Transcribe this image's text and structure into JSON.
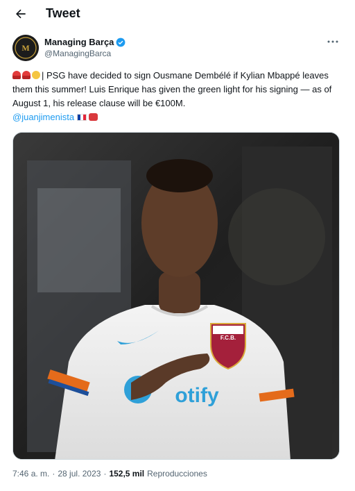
{
  "header": {
    "title": "Tweet",
    "back_icon": "arrow-left-icon"
  },
  "author": {
    "name": "Managing Barça",
    "handle": "@ManagingBarca",
    "verified_color": "#1d9bf0",
    "avatar_text": "MANAGING BARÇA",
    "avatar_monogram": "M"
  },
  "tweet": {
    "text": "| PSG have decided to sign Ousmane Dembélé if Kylian Mbappé leaves them this summer! Luis Enrique has given the green light for his signing — as of August 1, his release clause will be €100M.",
    "mention": "@juanjimenista",
    "emojis": [
      "siren-icon",
      "siren-icon",
      "moon-icon",
      "flag-france-icon",
      "phone-icon"
    ]
  },
  "media": {
    "crest_text": "F.C.B.",
    "sponsor_text": "otify",
    "accent_color": "#e46b1b"
  },
  "meta": {
    "time": "7:46 a. m.",
    "separator": "·",
    "date": "28 jul. 2023",
    "views": "152,5 mil",
    "views_label": "Reproducciones"
  },
  "colors": {
    "link": "#1d9bf0",
    "muted": "#536471",
    "text": "#0f1419"
  }
}
